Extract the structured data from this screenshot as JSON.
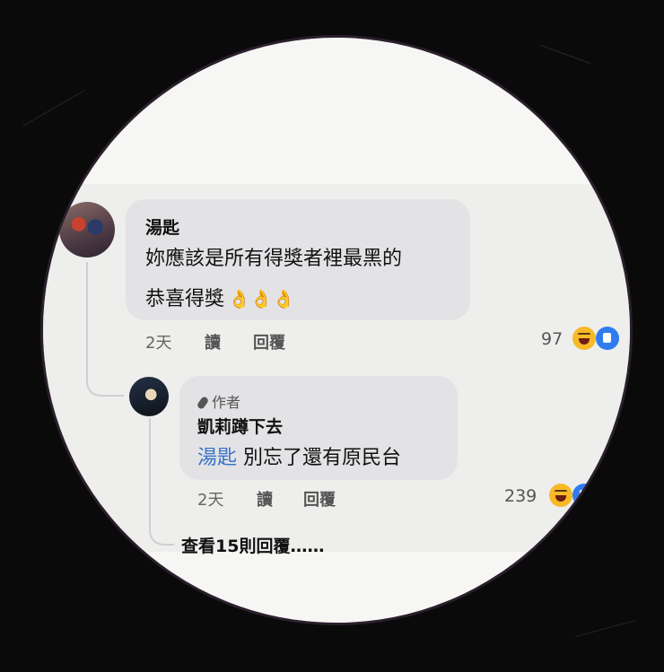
{
  "comment1": {
    "author": "湯匙",
    "line1": "妳應該是所有得獎者裡最黑的",
    "line2": "恭喜得獎",
    "emoji": "👌👌👌",
    "time": "2天",
    "action_read": "讀",
    "action_reply": "回覆",
    "reaction_count": "97"
  },
  "reply1": {
    "badge": "作者",
    "author": "凱莉蹲下去",
    "mention": "湯匙",
    "text": " 別忘了還有原民台",
    "time": "2天",
    "action_read": "讀",
    "action_reply": "回覆",
    "reaction_count": "239"
  },
  "view_more_label": "查看15則回覆……",
  "icons": {
    "haha": "haha-reaction-icon",
    "like": "like-reaction-icon",
    "author_mic": "microphone-icon"
  },
  "colors": {
    "mention": "#3a73c8",
    "bubble": "#e3e3e6",
    "haha": "#f7b928",
    "like": "#2f7cf0"
  }
}
